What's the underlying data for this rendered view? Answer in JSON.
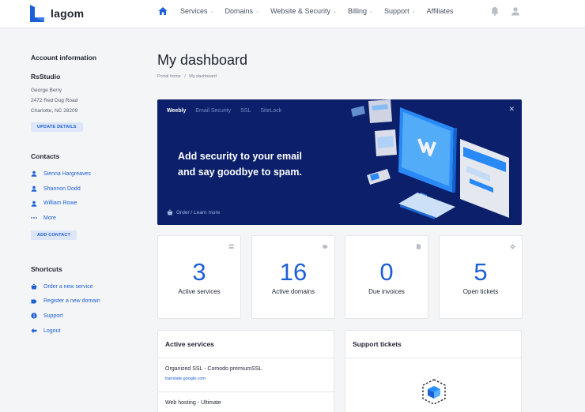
{
  "brand": {
    "name": "lagom",
    "color": "#1d5fd6"
  },
  "nav": {
    "items": [
      {
        "label": "Services",
        "dropdown": true
      },
      {
        "label": "Domains",
        "dropdown": true
      },
      {
        "label": "Website & Security",
        "dropdown": true
      },
      {
        "label": "Billing",
        "dropdown": true
      },
      {
        "label": "Support",
        "dropdown": true
      },
      {
        "label": "Affiliates",
        "dropdown": false
      }
    ],
    "icons": [
      "home-icon",
      "bell-icon",
      "user-icon"
    ]
  },
  "sidebar": {
    "account_heading": "Account information",
    "company": "RsStudio",
    "address": [
      "George Berry",
      "2472 Red Dog Road",
      "Charlotte, NC 28209"
    ],
    "update_button": "UPDATE DETAILS",
    "contacts_heading": "Contacts",
    "contacts": [
      "Sienna Hargreaves",
      "Shannon Dodd",
      "William Rowe"
    ],
    "more_label": "More",
    "add_contact_button": "ADD CONTACT",
    "shortcuts_heading": "Shortcuts",
    "shortcuts": [
      {
        "label": "Order a new service",
        "icon": "basket-icon"
      },
      {
        "label": "Register a new domain",
        "icon": "tag-icon"
      },
      {
        "label": "Support",
        "icon": "info-icon"
      },
      {
        "label": "Logout",
        "icon": "logout-icon"
      }
    ]
  },
  "page": {
    "title": "My dashboard",
    "breadcrumb": [
      "Portal home",
      "/",
      "My dashboard"
    ]
  },
  "banner": {
    "tabs": [
      "Weebly",
      "Email Security",
      "SSL",
      "SiteLock"
    ],
    "active_tab": "Weebly",
    "headline_line1": "Add security to your email",
    "headline_line2": "and say goodbye to spam.",
    "cta": "Order / Learn more",
    "close": "✕",
    "background": "#0b1f6b"
  },
  "stats": [
    {
      "value": "3",
      "label": "Active services",
      "icon": "server-icon"
    },
    {
      "value": "16",
      "label": "Active domains",
      "icon": "tag-icon"
    },
    {
      "value": "0",
      "label": "Due invoices",
      "icon": "file-icon"
    },
    {
      "value": "5",
      "label": "Open tickets",
      "icon": "ticket-icon"
    }
  ],
  "active_services": {
    "heading": "Active services",
    "items": [
      {
        "name": "Organized SSL - Comodo premiumSSL",
        "url": "translate.google.com"
      },
      {
        "name": "Web hosting - Ultimate",
        "url": ""
      }
    ]
  },
  "support_tickets": {
    "heading": "Support tickets"
  }
}
